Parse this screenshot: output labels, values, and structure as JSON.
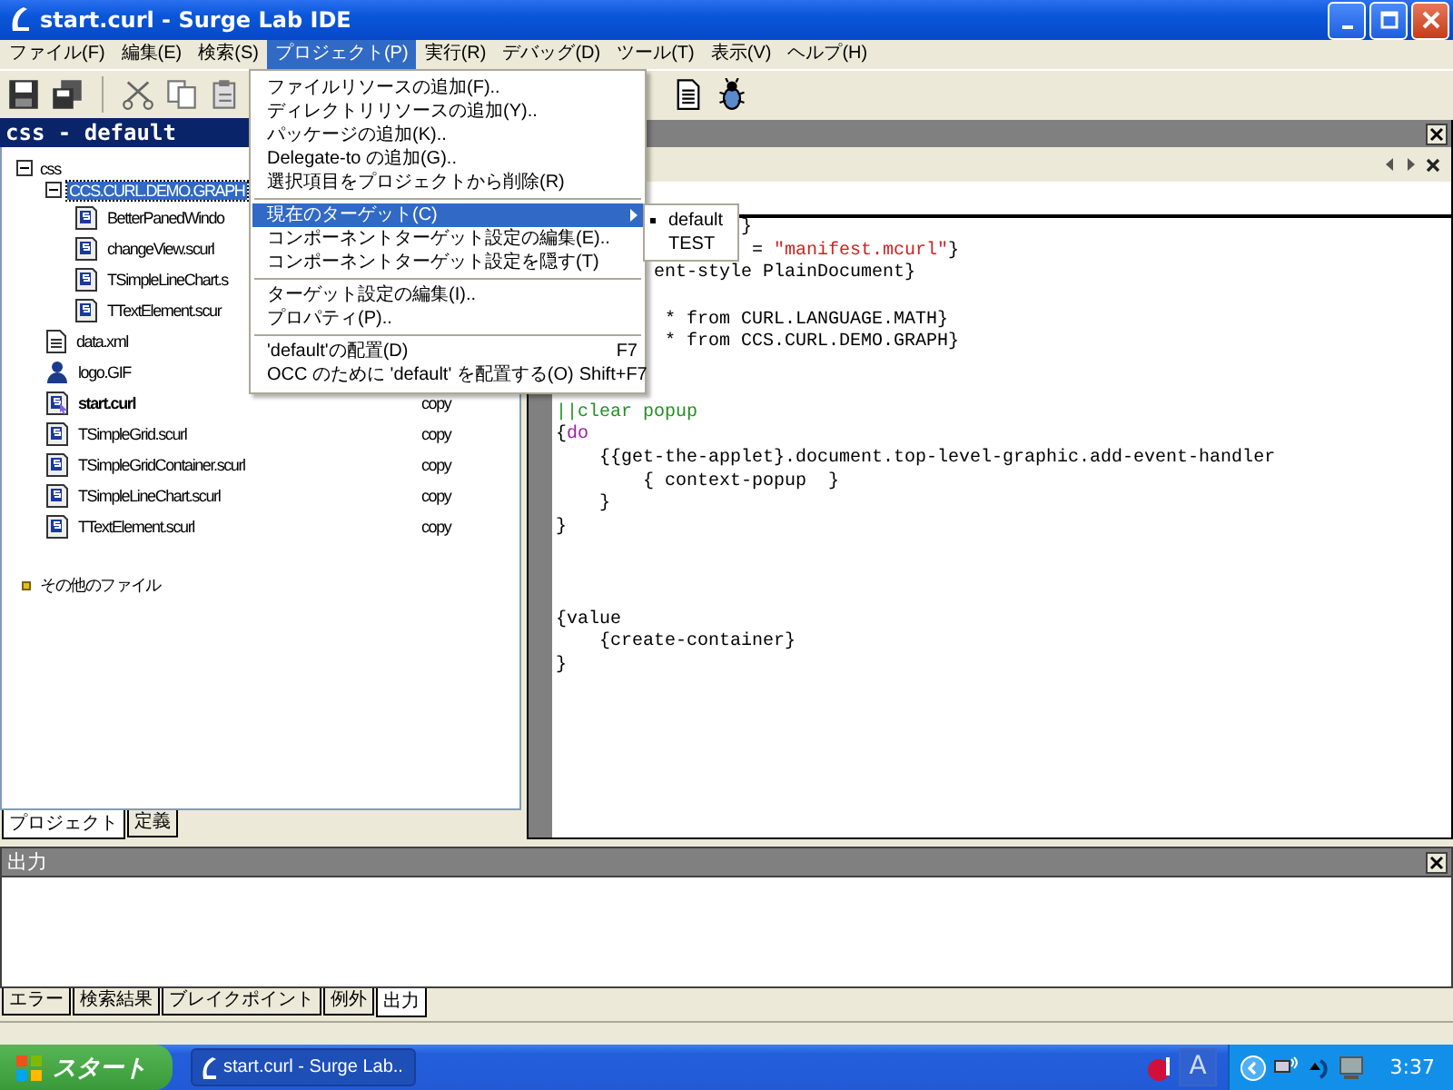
{
  "window": {
    "title": "start.curl - Surge Lab IDE"
  },
  "menu_bar": [
    {
      "label": "ファイル(F)",
      "selected": false
    },
    {
      "label": "編集(E)",
      "selected": false
    },
    {
      "label": "検索(S)",
      "selected": false
    },
    {
      "label": "プロジェクト(P)",
      "selected": true
    },
    {
      "label": "実行(R)",
      "selected": false
    },
    {
      "label": "デバッグ(D)",
      "selected": false
    },
    {
      "label": "ツール(T)",
      "selected": false
    },
    {
      "label": "表示(V)",
      "selected": false
    },
    {
      "label": "ヘルプ(H)",
      "selected": false
    }
  ],
  "open_menu": {
    "items": [
      {
        "kind": "item",
        "label": "ファイルリソースの追加(F)..",
        "selected": false
      },
      {
        "kind": "item",
        "label": "ディレクトリリソースの追加(Y)..",
        "selected": false
      },
      {
        "kind": "item",
        "label": "パッケージの追加(K)..",
        "selected": false
      },
      {
        "kind": "item",
        "label": "Delegate-to の追加(G)..",
        "selected": false
      },
      {
        "kind": "item",
        "label": "選択項目をプロジェクトから削除(R)",
        "selected": false
      },
      {
        "kind": "separator"
      },
      {
        "kind": "submenu",
        "label": "現在のターゲット(C)",
        "selected": true
      },
      {
        "kind": "item",
        "label": "コンポーネントターゲット設定の編集(E)..",
        "selected": false
      },
      {
        "kind": "item",
        "label": "コンポーネントターゲット設定を隠す(T)",
        "selected": false
      },
      {
        "kind": "separator"
      },
      {
        "kind": "item",
        "label": "ターゲット設定の編集(I)..",
        "selected": false
      },
      {
        "kind": "item",
        "label": "プロパティ(P)..",
        "selected": false
      },
      {
        "kind": "separator"
      },
      {
        "kind": "item",
        "label": "'default'の配置(D)",
        "shortcut": "F7",
        "selected": false
      },
      {
        "kind": "item",
        "label": "OCC のために 'default' を配置する(O)",
        "shortcut": "Shift+F7",
        "selected": false
      }
    ],
    "submenu": [
      {
        "label": "default",
        "selected": true
      },
      {
        "label": "TEST",
        "selected": false
      }
    ]
  },
  "project_panel": {
    "title": "css - default",
    "tree": [
      {
        "label": "css",
        "kind": "folder",
        "expanded": true,
        "selected": false,
        "children": [
          {
            "label": "CCS.CURL.DEMO.GRAPH",
            "kind": "package",
            "expanded": true,
            "selected": true,
            "children": [
              {
                "label": "BetterPanedWindo",
                "kind": "scurl",
                "selected": false
              },
              {
                "label": "changeView.scurl",
                "kind": "scurl",
                "selected": false
              },
              {
                "label": "TSimpleLineChart.s",
                "kind": "scurl",
                "selected": false
              },
              {
                "label": "TTextElement.scur",
                "kind": "scurl",
                "selected": false
              }
            ]
          },
          {
            "label": "data.xml",
            "kind": "xml",
            "selected": false
          },
          {
            "label": "logo.GIF",
            "kind": "image",
            "selected": false
          },
          {
            "label": "start.curl",
            "kind": "start",
            "selected": false,
            "column_2": "copy"
          },
          {
            "label": "TSimpleGrid.scurl",
            "kind": "scurl",
            "selected": false,
            "column_2": "copy"
          },
          {
            "label": "TSimpleGridContainer.scurl",
            "kind": "scurl",
            "selected": false,
            "column_2": "copy"
          },
          {
            "label": "TSimpleLineChart.scurl",
            "kind": "scurl",
            "selected": false,
            "column_2": "copy"
          },
          {
            "label": "TTextElement.scurl",
            "kind": "scurl",
            "selected": false,
            "column_2": "copy"
          }
        ]
      },
      {
        "label": "その他のファイル",
        "kind": "other",
        "selected": false
      }
    ],
    "tabs": [
      {
        "label": "プロジェクト",
        "selected": true
      },
      {
        "label": "定義",
        "selected": false
      }
    ]
  },
  "editor": {
    "lines": [
      {
        "kind": "tail",
        "parts": [
          {
            "kind": "plain",
            "text": "}"
          }
        ]
      },
      {
        "kind": "tail",
        "parts": [
          {
            "kind": "plain",
            "text": "= "
          },
          {
            "kind": "string",
            "text": "\"manifest.mcurl\""
          },
          {
            "kind": "plain",
            "text": "}"
          }
        ]
      },
      {
        "kind": "tail",
        "parts": [
          {
            "kind": "plain",
            "text": "ent-style PlainDocument}"
          }
        ]
      },
      {
        "kind": "blank"
      },
      {
        "kind": "tail",
        "parts": [
          {
            "kind": "plain",
            "text": "* from CURL.LANGUAGE.MATH}"
          }
        ]
      },
      {
        "kind": "tail",
        "parts": [
          {
            "kind": "plain",
            "text": "* from CCS.CURL.DEMO.GRAPH}"
          }
        ]
      },
      {
        "kind": "blank"
      },
      {
        "kind": "blank"
      },
      {
        "kind": "code",
        "parts": [
          {
            "kind": "comment",
            "text": "||clear popup"
          }
        ]
      },
      {
        "kind": "code",
        "parts": [
          {
            "kind": "plain",
            "text": "{"
          },
          {
            "kind": "keyword",
            "text": "do"
          }
        ]
      },
      {
        "kind": "code",
        "parts": [
          {
            "kind": "plain",
            "text": "    {{get-the-applet}.document.top-level-graphic.add-event-handler"
          }
        ]
      },
      {
        "kind": "code",
        "parts": [
          {
            "kind": "plain",
            "text": "        { context-popup  }"
          }
        ]
      },
      {
        "kind": "code",
        "parts": [
          {
            "kind": "plain",
            "text": "    }"
          }
        ]
      },
      {
        "kind": "code",
        "parts": [
          {
            "kind": "plain",
            "text": "}"
          }
        ]
      },
      {
        "kind": "blank"
      },
      {
        "kind": "blank"
      },
      {
        "kind": "blank"
      },
      {
        "kind": "code",
        "parts": [
          {
            "kind": "plain",
            "text": "{value"
          }
        ]
      },
      {
        "kind": "code",
        "parts": [
          {
            "kind": "plain",
            "text": "    {create-container}"
          }
        ]
      },
      {
        "kind": "code",
        "parts": [
          {
            "kind": "plain",
            "text": "}"
          }
        ]
      }
    ]
  },
  "output_panel": {
    "title": "出力",
    "tabs": [
      {
        "label": "エラー",
        "selected": false
      },
      {
        "label": "検索結果",
        "selected": false
      },
      {
        "label": "ブレイクポイント",
        "selected": false
      },
      {
        "label": "例外",
        "selected": false
      },
      {
        "label": "出力",
        "selected": true
      }
    ]
  },
  "taskbar": {
    "start": "スタート",
    "tasks": [
      {
        "label": "start.curl - Surge Lab..",
        "selected": true
      }
    ],
    "ime_mode": "A",
    "clock": "3:37"
  }
}
